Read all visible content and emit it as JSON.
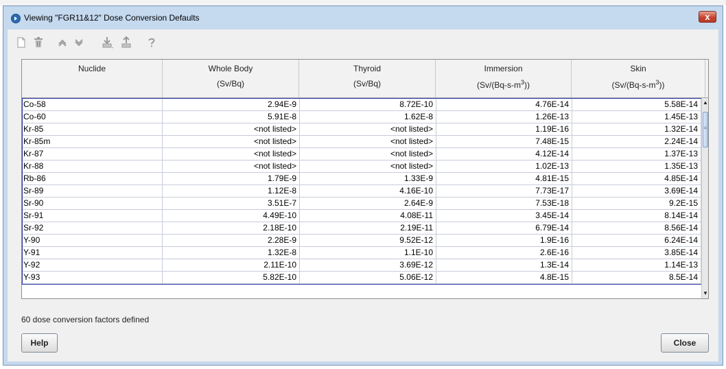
{
  "window": {
    "title": "Viewing \"FGR11&12\" Dose Conversion Defaults",
    "close_label": "x"
  },
  "toolbar": {
    "icons": [
      "new-document-icon",
      "delete-icon",
      "move-up-icon",
      "move-down-icon",
      "import-icon",
      "export-icon",
      "help-icon"
    ]
  },
  "table": {
    "columns": [
      {
        "line1": "Nuclide",
        "line2": ""
      },
      {
        "line1": "Whole Body",
        "line2": "(Sv/Bq)"
      },
      {
        "line1": "Thyroid",
        "line2": "(Sv/Bq)"
      },
      {
        "line1": "Immersion",
        "line2": "(Sv/(Bq-s-m",
        "sup": "3",
        "tail": "))"
      },
      {
        "line1": "Skin",
        "line2": "(Sv/(Bq-s-m",
        "sup": "3",
        "tail": "))"
      }
    ],
    "rows": [
      [
        "Co-58",
        "2.94E-9",
        "8.72E-10",
        "4.76E-14",
        "5.58E-14"
      ],
      [
        "Co-60",
        "5.91E-8",
        "1.62E-8",
        "1.26E-13",
        "1.45E-13"
      ],
      [
        "Kr-85",
        "<not listed>",
        "<not listed>",
        "1.19E-16",
        "1.32E-14"
      ],
      [
        "Kr-85m",
        "<not listed>",
        "<not listed>",
        "7.48E-15",
        "2.24E-14"
      ],
      [
        "Kr-87",
        "<not listed>",
        "<not listed>",
        "4.12E-14",
        "1.37E-13"
      ],
      [
        "Kr-88",
        "<not listed>",
        "<not listed>",
        "1.02E-13",
        "1.35E-13"
      ],
      [
        "Rb-86",
        "1.79E-9",
        "1.33E-9",
        "4.81E-15",
        "4.85E-14"
      ],
      [
        "Sr-89",
        "1.12E-8",
        "4.16E-10",
        "7.73E-17",
        "3.69E-14"
      ],
      [
        "Sr-90",
        "3.51E-7",
        "2.64E-9",
        "7.53E-18",
        "9.2E-15"
      ],
      [
        "Sr-91",
        "4.49E-10",
        "4.08E-11",
        "3.45E-14",
        "8.14E-14"
      ],
      [
        "Sr-92",
        "2.18E-10",
        "2.19E-11",
        "6.79E-14",
        "8.56E-14"
      ],
      [
        "Y-90",
        "2.28E-9",
        "9.52E-12",
        "1.9E-16",
        "6.24E-14"
      ],
      [
        "Y-91",
        "1.32E-8",
        "1.1E-10",
        "2.6E-16",
        "3.85E-14"
      ],
      [
        "Y-92",
        "2.11E-10",
        "3.69E-12",
        "1.3E-14",
        "1.14E-13"
      ],
      [
        "Y-93",
        "5.82E-10",
        "5.06E-12",
        "4.8E-15",
        "8.5E-14"
      ]
    ]
  },
  "status": "60 dose conversion factors defined",
  "buttons": {
    "help": "Help",
    "close": "Close"
  }
}
